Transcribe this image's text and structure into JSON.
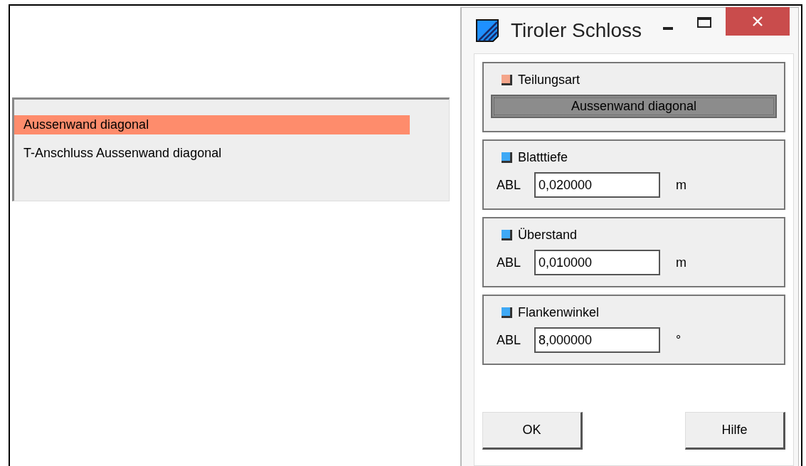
{
  "list": {
    "items": [
      {
        "label": "Aussenwand diagonal",
        "selected": true
      },
      {
        "label": "T-Anschluss Aussenwand diagonal",
        "selected": false
      }
    ]
  },
  "dialog": {
    "title": "Tiroler Schloss",
    "groups": [
      {
        "kind": "choice",
        "title": "Teilungsart",
        "color": "#f4a58a",
        "value": "Aussenwand diagonal"
      },
      {
        "kind": "field",
        "title": "Blatttiefe",
        "color": "#3fa9f5",
        "prefix": "ABL",
        "value": "0,020000",
        "unit": "m"
      },
      {
        "kind": "field",
        "title": "Überstand",
        "color": "#3fa9f5",
        "prefix": "ABL",
        "value": "0,010000",
        "unit": "m"
      },
      {
        "kind": "field",
        "title": "Flankenwinkel",
        "color": "#3fa9f5",
        "prefix": "ABL",
        "value": "8,000000",
        "unit": "°"
      }
    ],
    "buttons": [
      "OK",
      "Hilfe"
    ]
  }
}
